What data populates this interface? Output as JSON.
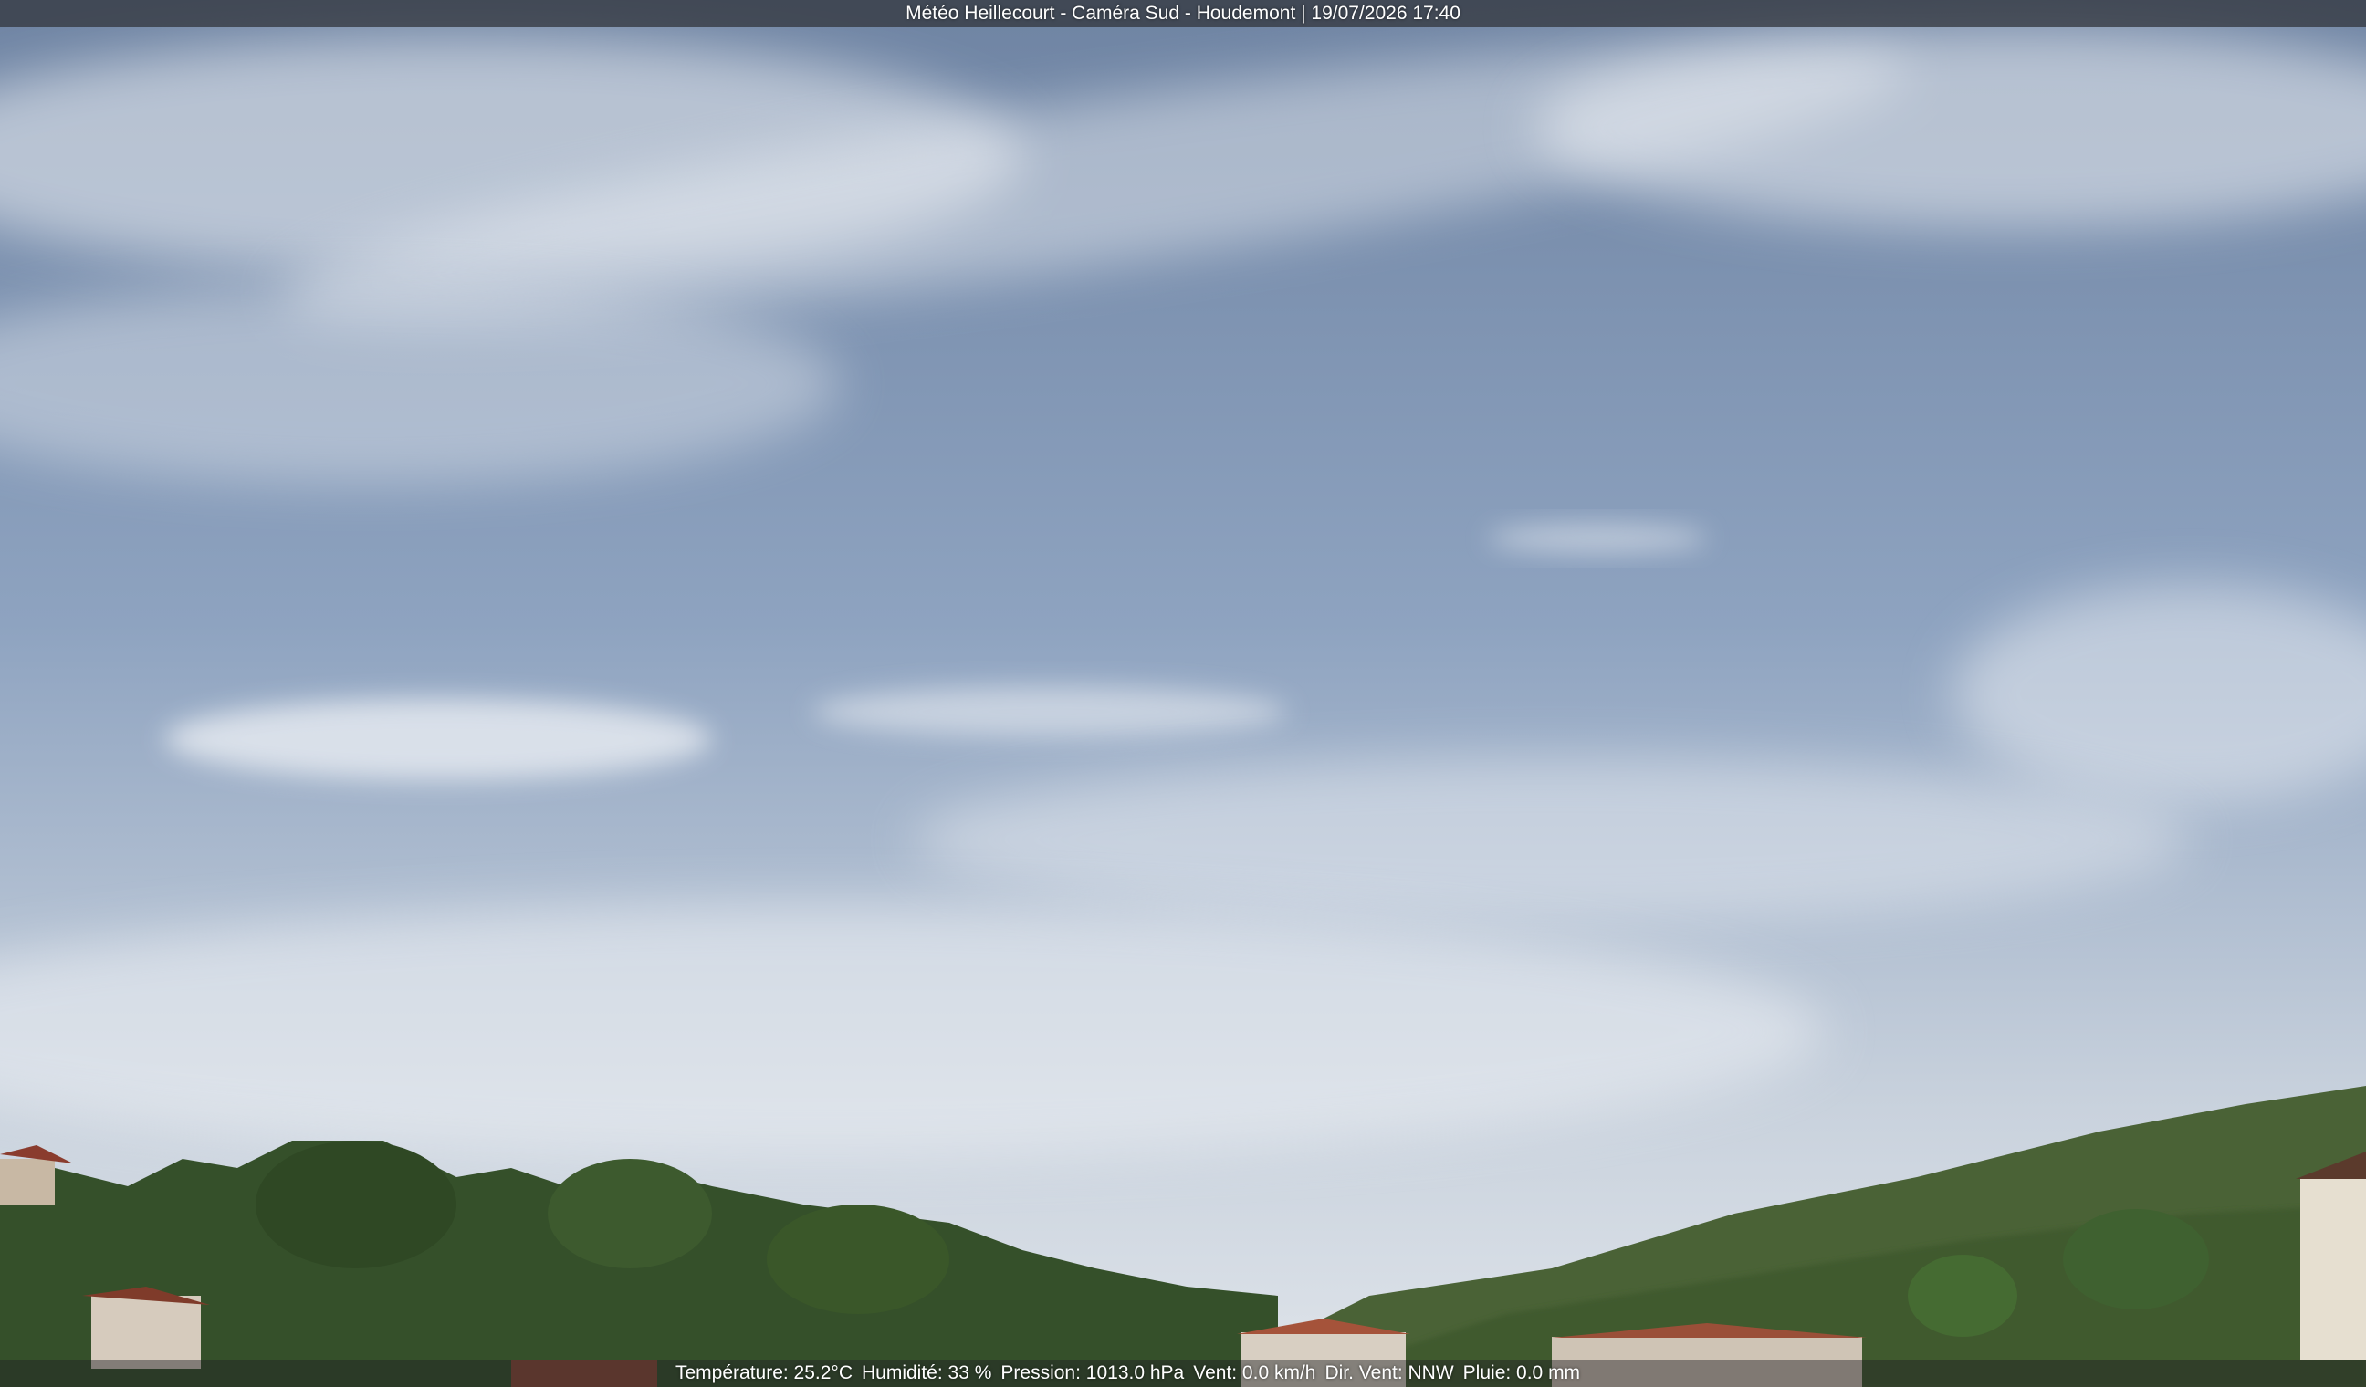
{
  "overlay": {
    "title": "Météo Heillecourt - Caméra Sud - Houdemont | 19/07/2026 17:40",
    "weather": {
      "temperature": "Température: 25.2°C",
      "humidity": "Humidité: 33 %",
      "pressure": "Pression: 1013.0 hPa",
      "wind": "Vent: 0.0 km/h",
      "wind_dir": "Dir. Vent: NNW",
      "rain": "Pluie: 0.0 mm"
    }
  },
  "scene": {
    "sky_color_top": "#6f84a3",
    "sky_color_horizon": "#d9dfe6",
    "vegetation_color": "#3c5a2a",
    "roof_color": "#a5533a"
  }
}
